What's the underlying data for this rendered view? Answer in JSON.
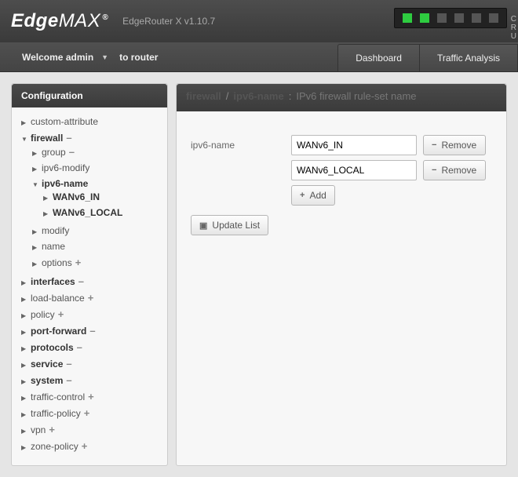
{
  "header": {
    "logo_main": "Edge",
    "logo_sub": "MAX",
    "device": "EdgeRouter X v1.10.7",
    "ports": [
      true,
      true,
      false,
      false,
      false,
      false
    ],
    "side_text": "C\nR\nU"
  },
  "subheader": {
    "welcome_prefix": "Welcome",
    "user": "admin",
    "to_router": "to router",
    "tabs": [
      "Dashboard",
      "Traffic Analysis"
    ]
  },
  "sidebar": {
    "title": "Configuration",
    "items": [
      {
        "label": "custom-attribute",
        "expand": "right",
        "bold": false
      },
      {
        "label": "firewall",
        "expand": "down",
        "bold": true,
        "suffix": "–",
        "children": [
          {
            "label": "group",
            "expand": "right",
            "suffix": "–"
          },
          {
            "label": "ipv6-modify",
            "expand": "right"
          },
          {
            "label": "ipv6-name",
            "expand": "down",
            "bold": true,
            "children": [
              {
                "label": "WANv6_IN",
                "expand": "right",
                "bold": true
              },
              {
                "label": "WANv6_LOCAL",
                "expand": "right",
                "bold": true
              }
            ]
          },
          {
            "label": "modify",
            "expand": "right"
          },
          {
            "label": "name",
            "expand": "right"
          },
          {
            "label": "options",
            "expand": "right",
            "suffix": "+"
          }
        ]
      },
      {
        "label": "interfaces",
        "expand": "right",
        "bold": true,
        "suffix": "–"
      },
      {
        "label": "load-balance",
        "expand": "right",
        "suffix": "+"
      },
      {
        "label": "policy",
        "expand": "right",
        "suffix": "+"
      },
      {
        "label": "port-forward",
        "expand": "right",
        "bold": true,
        "suffix": "–"
      },
      {
        "label": "protocols",
        "expand": "right",
        "bold": true,
        "suffix": "–"
      },
      {
        "label": "service",
        "expand": "right",
        "bold": true,
        "suffix": "–"
      },
      {
        "label": "system",
        "expand": "right",
        "bold": true,
        "suffix": "–"
      },
      {
        "label": "traffic-control",
        "expand": "right",
        "suffix": "+"
      },
      {
        "label": "traffic-policy",
        "expand": "right",
        "suffix": "+"
      },
      {
        "label": "vpn",
        "expand": "right",
        "suffix": "+"
      },
      {
        "label": "zone-policy",
        "expand": "right",
        "suffix": "+"
      }
    ]
  },
  "main": {
    "breadcrumb": [
      "firewall",
      "ipv6-name"
    ],
    "description": "IPv6 firewall rule-set name",
    "field_label": "ipv6-name",
    "values": [
      "WANv6_IN",
      "WANv6_LOCAL"
    ],
    "remove_label": "Remove",
    "add_label": "Add",
    "update_label": "Update List"
  }
}
